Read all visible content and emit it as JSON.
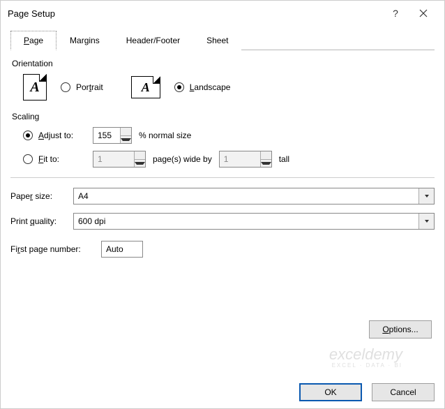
{
  "title": "Page Setup",
  "tabs": [
    "Page",
    "Margins",
    "Header/Footer",
    "Sheet"
  ],
  "active_tab": 0,
  "orientation": {
    "label": "Orientation",
    "portrait": "Portrait",
    "landscape": "Landscape",
    "selected": "landscape"
  },
  "scaling": {
    "label": "Scaling",
    "adjust_to": "Adjust to:",
    "adjust_value": "155",
    "adjust_suffix": "% normal size",
    "fit_to": "Fit to:",
    "fit_wide": "1",
    "fit_mid": "page(s) wide by",
    "fit_tall": "1",
    "fit_suffix": "tall",
    "selected": "adjust"
  },
  "paper_size": {
    "label": "Paper size:",
    "value": "A4"
  },
  "print_quality": {
    "label": "Print quality:",
    "value": "600 dpi"
  },
  "first_page": {
    "label": "First page number:",
    "value": "Auto"
  },
  "buttons": {
    "options": "Options...",
    "ok": "OK",
    "cancel": "Cancel"
  },
  "watermark": {
    "big": "exceldemy",
    "small": "EXCEL · DATA · BI"
  }
}
